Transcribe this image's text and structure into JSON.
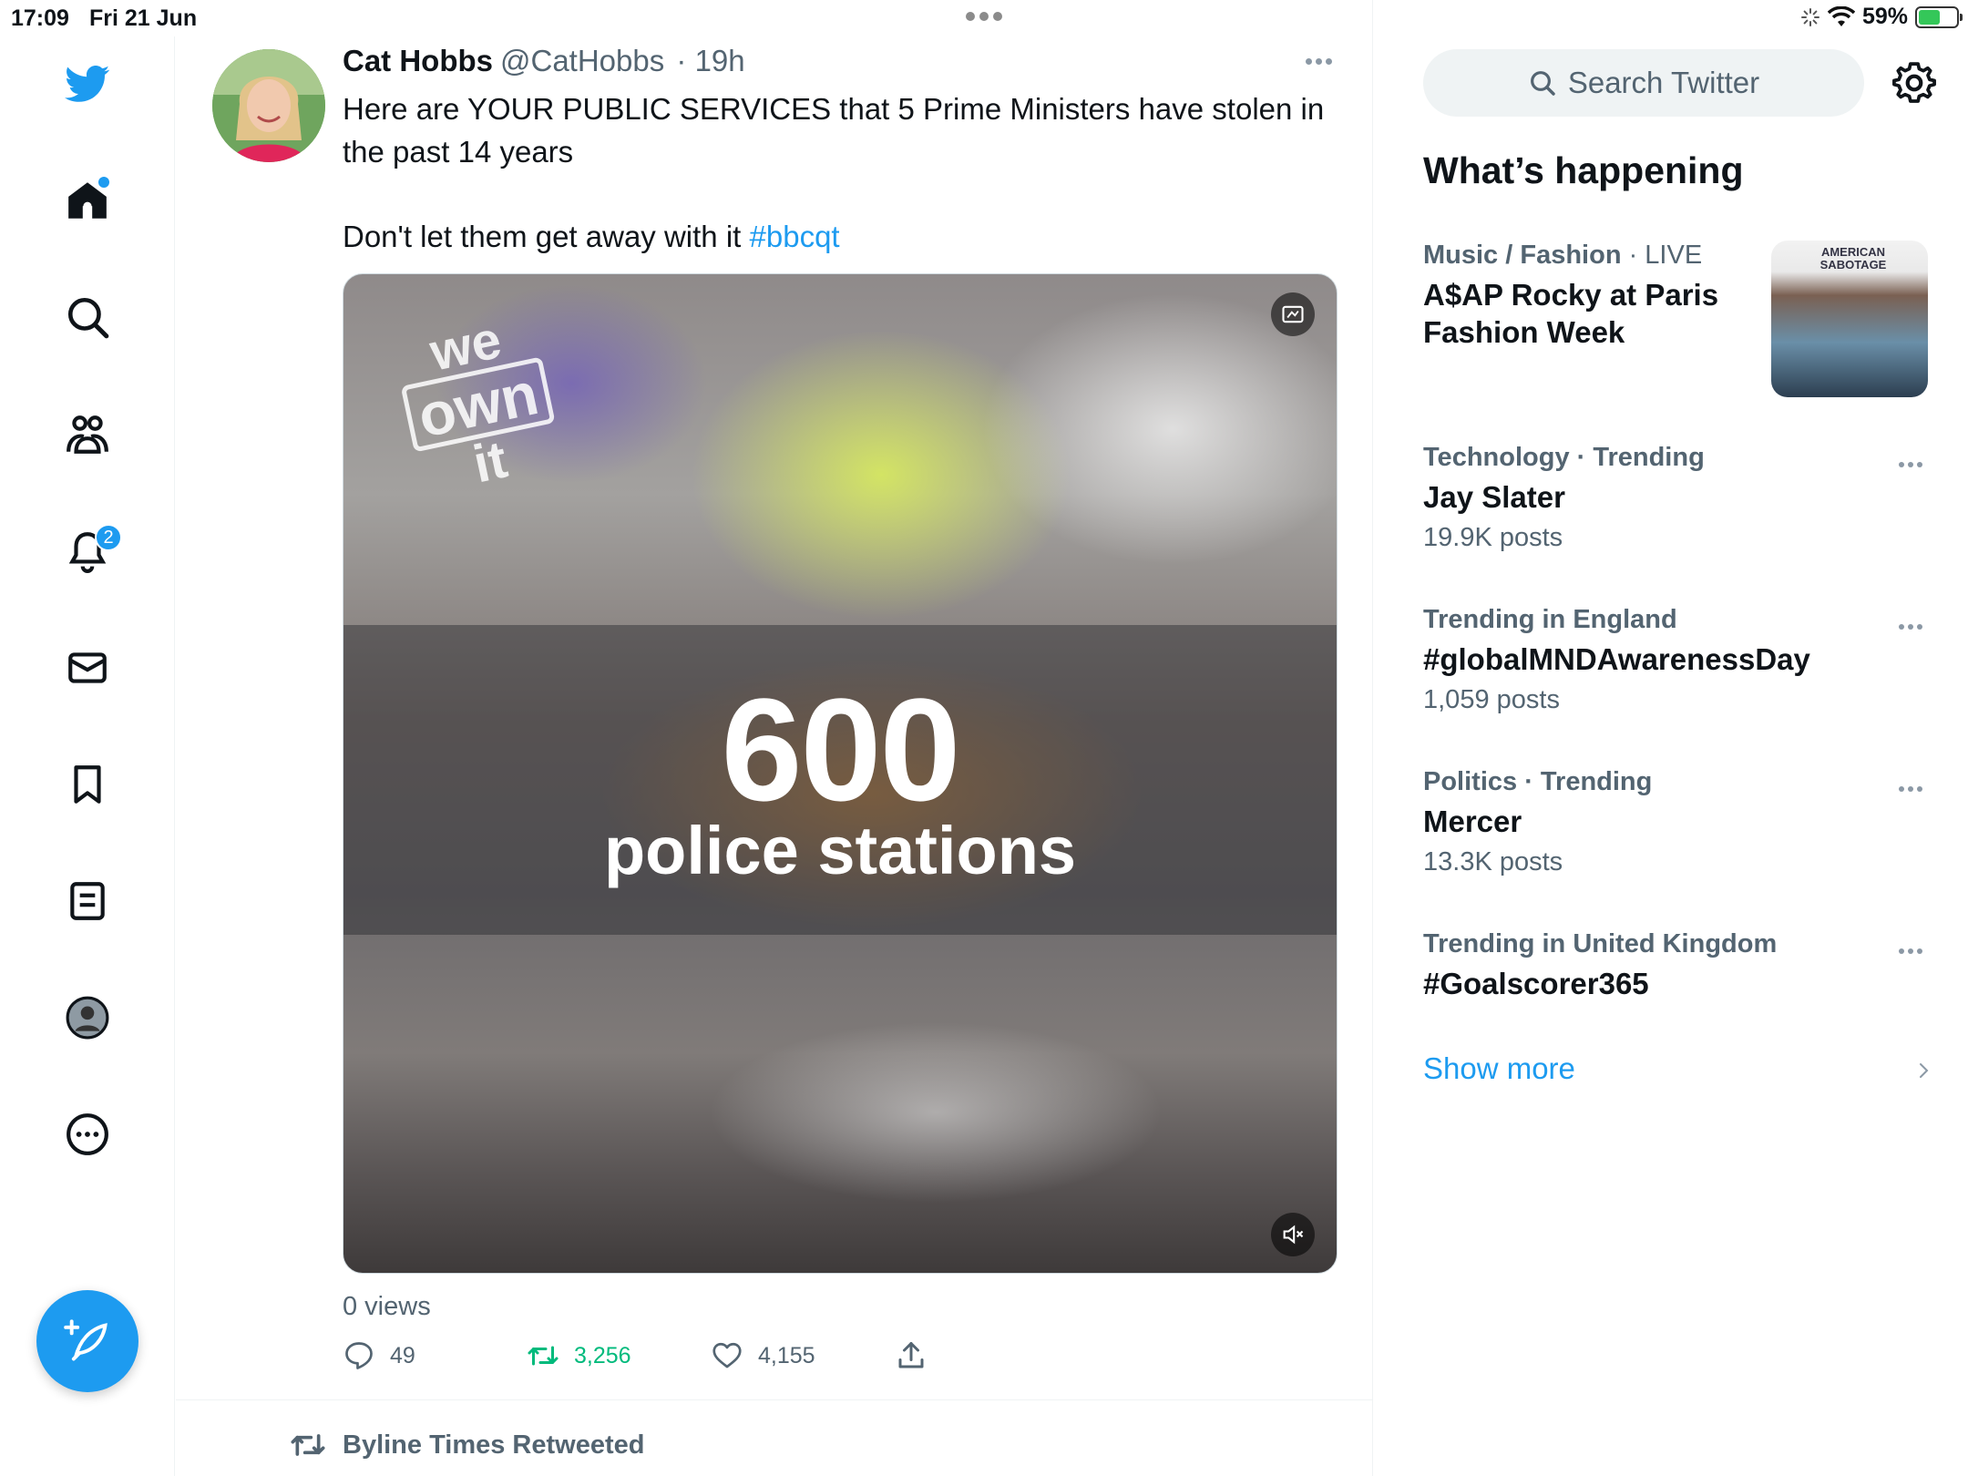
{
  "status_bar": {
    "time": "17:09",
    "date": "Fri 21 Jun",
    "battery": "59%",
    "battery_level": 0.59
  },
  "nav": {
    "items": [
      {
        "name": "twitter-logo",
        "icon": "bird-icon"
      },
      {
        "name": "home",
        "icon": "home-icon"
      },
      {
        "name": "explore",
        "icon": "search-icon"
      },
      {
        "name": "communities",
        "icon": "people-icon"
      },
      {
        "name": "notifications",
        "icon": "bell-icon",
        "badge": "2"
      },
      {
        "name": "messages",
        "icon": "mail-icon"
      },
      {
        "name": "bookmarks",
        "icon": "bookmark-icon"
      },
      {
        "name": "lists",
        "icon": "list-icon"
      },
      {
        "name": "profile",
        "icon": "person-icon"
      },
      {
        "name": "more",
        "icon": "more-circle-icon"
      }
    ],
    "notification_badge": "2",
    "compose_icon": "compose-feather-icon"
  },
  "tweet": {
    "author_name": "Cat Hobbs",
    "author_handle": "@CatHobbs",
    "time": "· 19h",
    "text_line1": "Here are YOUR PUBLIC SERVICES that 5 Prime Ministers have stolen in the past 14 years",
    "text_line2": "Don't let them get away with it",
    "hashtag": "#bbcqt",
    "media": {
      "logo_line1": "we",
      "logo_line2": "own",
      "logo_line3": "it",
      "big_number": "600",
      "big_label": "police stations"
    },
    "views": "0 views",
    "replies": "49",
    "retweets": "3,256",
    "likes": "4,155"
  },
  "next_tweet": {
    "retweeted_by": "Byline Times Retweeted"
  },
  "sidebar": {
    "search_placeholder": "Search Twitter",
    "section_title": "What’s happening",
    "trends": [
      {
        "category": "Music / Fashion",
        "status": "· LIVE",
        "title_line1": "A$AP Rocky at Paris",
        "title_line2": "Fashion Week"
      },
      {
        "category": "Technology · Trending",
        "title": "Jay Slater",
        "count": "19.9K posts"
      },
      {
        "category": "Trending in England",
        "title": "#globalMNDAwarenessDay",
        "count": "1,059 posts"
      },
      {
        "category": "Politics · Trending",
        "title": "Mercer",
        "count": "13.3K posts"
      },
      {
        "category": "Trending in United Kingdom",
        "title": "#Goalscorer365"
      }
    ],
    "trend_image_text": "AMERICAN SABOTAGE",
    "show_more": "Show more"
  },
  "colors": {
    "accent": "#1d9bf0",
    "retweet_green": "#00ba7c",
    "secondary_text": "#536471"
  }
}
